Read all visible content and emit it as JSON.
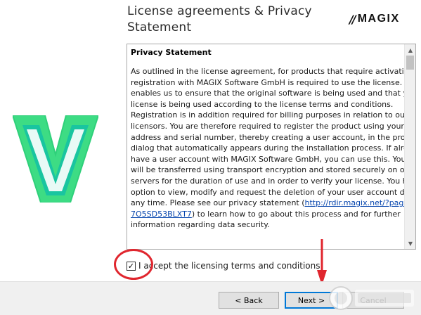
{
  "window": {
    "title_line1": "License agreements & Privacy",
    "title_line2": "Statement",
    "brand_mark": "//",
    "brand_name": "MAGIX"
  },
  "logo": {
    "icon": "v-logo-icon",
    "colors": {
      "green": "#3ddc84",
      "teal": "#19c5a0",
      "white": "#ffffff"
    }
  },
  "document": {
    "heading": "Privacy Statement",
    "lines": [
      "As outlined in the license agreement, for products that require activation,",
      "registration with MAGIX Software GmbH is required to use the license. This",
      "enables us to ensure that the original software is being used and that your",
      "license is being used according to the license terms and conditions.",
      "Registration is in addition required for billing purposes in relation to our",
      "licensors. You are therefore required to register the product using your email",
      "address and serial number, thereby creating a user account, in the program",
      "dialog that automatically appears during the installation process. If already",
      "have a user account with MAGIX Software GmbH, you can use this. Your data",
      "will be transferred using transport encryption and stored securely on our",
      "servers for the duration of use and in order to verify your license. You have the",
      "option to view, modify and request the deletion of your user account data at",
      "any time. Please see our privacy statement ("
    ],
    "link_part1": "http://rdir.magix.net/?page=",
    "line_after_link_pre": ") to learn how to go about this process and for further",
    "link_part2": "7O5SD53BLXT7",
    "line_last": "information regarding data security."
  },
  "scrollbar": {
    "up_icon": "▲",
    "down_icon": "▼"
  },
  "accept": {
    "checked": true,
    "check_glyph": "✓",
    "label": "I accept the licensing terms and conditions"
  },
  "buttons": {
    "back": "< Back",
    "next": "Next >",
    "cancel": "Cancel"
  },
  "colors": {
    "annotation_red": "#e0262e",
    "focus_blue": "#0078d7",
    "link_blue": "#0645ad"
  }
}
